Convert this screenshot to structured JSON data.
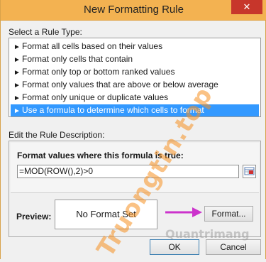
{
  "window": {
    "title": "New Formatting Rule",
    "close_glyph": "✕"
  },
  "select_section": {
    "label": "Select a Rule Type:",
    "mnemonic": "S"
  },
  "rule_types": [
    {
      "label": "Format all cells based on their values",
      "selected": false
    },
    {
      "label": "Format only cells that contain",
      "selected": false
    },
    {
      "label": "Format only top or bottom ranked values",
      "selected": false
    },
    {
      "label": "Format only values that are above or below average",
      "selected": false
    },
    {
      "label": "Format only unique or duplicate values",
      "selected": false
    },
    {
      "label": "Use a formula to determine which cells to format",
      "selected": true
    }
  ],
  "edit_section": {
    "label": "Edit the Rule Description:"
  },
  "formula": {
    "label": "Format values where this formula is true:",
    "value": "=MOD(ROW(),2)>0"
  },
  "preview": {
    "label": "Preview:",
    "text": "No Format Set"
  },
  "buttons": {
    "format": "Format...",
    "ok": "OK",
    "cancel": "Cancel"
  },
  "watermark": {
    "text": "Truongtin.top",
    "small": "Quantrimang"
  },
  "colors": {
    "titlebar": "#f3b251",
    "selection": "#3399ff",
    "close": "#c7362b",
    "annotation_arrow": "#cc33cc"
  }
}
